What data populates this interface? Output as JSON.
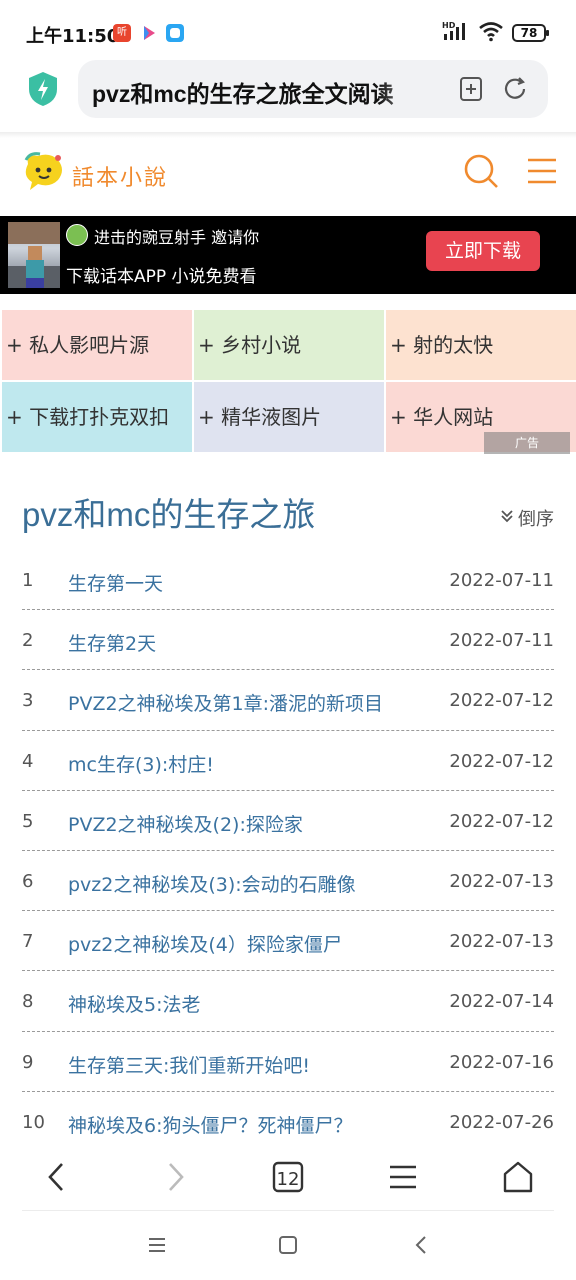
{
  "status_bar": {
    "time": "上午11:50",
    "app_icon_1_text": "听",
    "battery": "78",
    "network": "HD"
  },
  "address_bar": {
    "url_text": "pvz和mc的生存之旅全文阅读"
  },
  "site": {
    "logo_text": "話本小說"
  },
  "app_banner": {
    "line1": "进击的豌豆射手 邀请你",
    "line2": "下载话本APP 小说免费看",
    "button": "立即下载"
  },
  "ad_grid": {
    "cells": [
      {
        "label": "+ 私人影吧片源",
        "bg": "#fcd9d5"
      },
      {
        "label": "+ 乡村小说",
        "bg": "#dff0d3"
      },
      {
        "label": "+ 射的太快",
        "bg": "#fde2d0"
      },
      {
        "label": "+ 下载打扑克双扣",
        "bg": "#bfe8ee"
      },
      {
        "label": "+ 精华液图片",
        "bg": "#dfe3f0"
      },
      {
        "label": "+ 华人网站",
        "bg": "#fbd9d4"
      }
    ],
    "ad_badge": "广告"
  },
  "book": {
    "title": "pvz和mc的生存之旅",
    "sort_label": "倒序"
  },
  "chapters": [
    {
      "num": "1",
      "title": "生存第一天",
      "date": "2022-07-11"
    },
    {
      "num": "2",
      "title": "生存第2天",
      "date": "2022-07-11"
    },
    {
      "num": "3",
      "title": "PVZ2之神秘埃及第1章:潘泥的新项目",
      "date": "2022-07-12"
    },
    {
      "num": "4",
      "title": "mc生存(3):村庄!",
      "date": "2022-07-12"
    },
    {
      "num": "5",
      "title": "PVZ2之神秘埃及(2):探险家",
      "date": "2022-07-12"
    },
    {
      "num": "6",
      "title": "pvz2之神秘埃及(3):会动的石雕像",
      "date": "2022-07-13"
    },
    {
      "num": "7",
      "title": "pvz2之神秘埃及(4）探险家僵尸",
      "date": "2022-07-13"
    },
    {
      "num": "8",
      "title": "神秘埃及5:法老",
      "date": "2022-07-14"
    },
    {
      "num": "9",
      "title": "生存第三天:我们重新开始吧!",
      "date": "2022-07-16"
    },
    {
      "num": "10",
      "title": "神秘埃及6:狗头僵尸？死神僵尸？",
      "date": "2022-07-26"
    }
  ],
  "bottom_bar": {
    "tab_count": "12"
  },
  "colors": {
    "accent_orange": "#f08a2e",
    "link_blue": "#3a72a0",
    "download_red": "#e84450",
    "shield_teal": "#3bbfa3"
  }
}
